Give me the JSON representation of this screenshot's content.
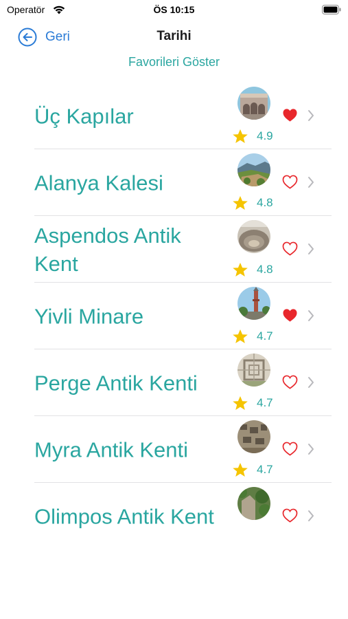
{
  "status_bar": {
    "carrier": "Operatör",
    "time": "ÖS 10:15"
  },
  "nav": {
    "back_label": "Geri",
    "title": "Tarihi"
  },
  "favorites_toggle": "Favorileri Göster",
  "colors": {
    "accent_teal": "#2aa6a0",
    "back_blue": "#2a7bd6",
    "heart_red": "#e8272c",
    "star_yellow": "#f5c400"
  },
  "places": [
    {
      "name": "Üç Kapılar",
      "rating": "4.9",
      "favorite": true,
      "thumb_icon": "gate-photo"
    },
    {
      "name": "Alanya Kalesi",
      "rating": "4.8",
      "favorite": false,
      "thumb_icon": "castle-photo"
    },
    {
      "name": "Aspendos Antik Kent",
      "rating": "4.8",
      "favorite": false,
      "thumb_icon": "theater-photo"
    },
    {
      "name": "Yivli Minare",
      "rating": "4.7",
      "favorite": true,
      "thumb_icon": "minaret-photo"
    },
    {
      "name": "Perge Antik Kenti",
      "rating": "4.7",
      "favorite": false,
      "thumb_icon": "ruins-photo"
    },
    {
      "name": "Myra Antik Kenti",
      "rating": "4.7",
      "favorite": false,
      "thumb_icon": "rock-tombs-photo"
    },
    {
      "name": "Olimpos Antik Kent",
      "rating": "",
      "favorite": false,
      "thumb_icon": "forest-ruins-photo"
    }
  ]
}
